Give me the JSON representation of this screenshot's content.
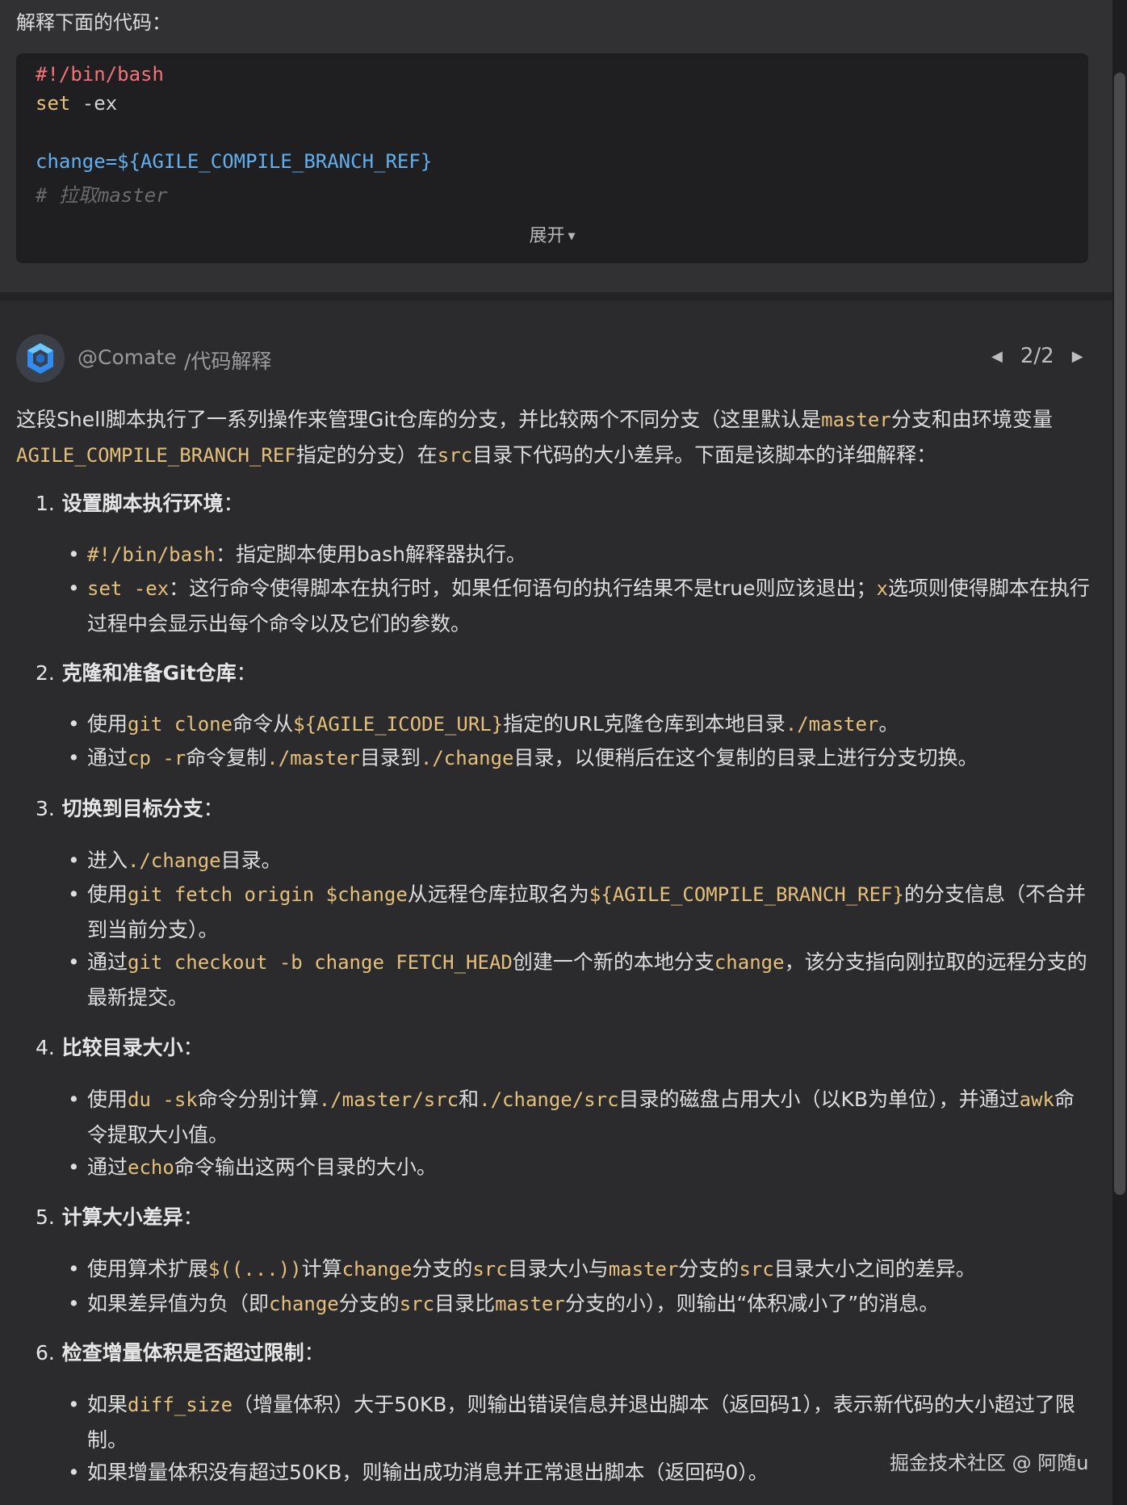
{
  "user": {
    "prompt": "解释下面的代码：",
    "code": {
      "shebang": "#!/bin/bash",
      "set_kw": "set",
      "set_arg": " -ex",
      "change_line": "change=${AGILE_COMPILE_BRANCH_REF}",
      "comment": "# 拉取master",
      "expand_label": "展开",
      "expand_icon": "▼"
    }
  },
  "assistant": {
    "name": "@Comate",
    "command": "/代码解释",
    "page": "2/2",
    "prev_icon": "◀",
    "next_icon": "▶"
  },
  "intro": {
    "p1": "这段Shell脚本执行了一系列操作来管理Git仓库的分支，并比较两个不同分支（这里默认是",
    "c1": "master",
    "p2": "分支和由环境变量",
    "c2": "AGILE_COMPILE_BRANCH_REF",
    "p3": "指定的分支）在",
    "c3": "src",
    "p4": "目录下代码的大小差异。下面是该脚本的详细解释："
  },
  "sections": {
    "s1": {
      "num": "1.",
      "title": "设置脚本执行环境",
      "colon": "：",
      "b1": {
        "c1": "#!/bin/bash",
        "t1": "：指定脚本使用bash解释器执行。"
      },
      "b2": {
        "c1": "set -ex",
        "t1": "：这行命令使得脚本在执行时，如果任何语句的执行结果不是true则应该退出；",
        "c2": "x",
        "t2": "选项则使得脚本在执行过程中会显示出每个命令以及它们的参数。"
      }
    },
    "s2": {
      "num": "2.",
      "title": "克隆和准备Git仓库",
      "colon": "：",
      "b1": {
        "t1": "使用",
        "c1": "git clone",
        "t2": "命令从",
        "c2": "${AGILE_ICODE_URL}",
        "t3": "指定的URL克隆仓库到本地目录",
        "c3": "./master",
        "t4": "。"
      },
      "b2": {
        "t1": "通过",
        "c1": "cp -r",
        "t2": "命令复制",
        "c2": "./master",
        "t3": "目录到",
        "c3": "./change",
        "t4": "目录，以便稍后在这个复制的目录上进行分支切换。"
      }
    },
    "s3": {
      "num": "3.",
      "title": "切换到目标分支",
      "colon": "：",
      "b1": {
        "t1": "进入",
        "c1": "./change",
        "t2": "目录。"
      },
      "b2": {
        "t1": "使用",
        "c1": "git fetch origin $change",
        "t2": "从远程仓库拉取名为",
        "c2": "${AGILE_COMPILE_BRANCH_REF}",
        "t3": "的分支信息（不合并到当前分支）。"
      },
      "b3": {
        "t1": "通过",
        "c1": "git checkout -b change FETCH_HEAD",
        "t2": "创建一个新的本地分支",
        "c2": "change",
        "t3": "，该分支指向刚拉取的远程分支的最新提交。"
      }
    },
    "s4": {
      "num": "4.",
      "title": "比较目录大小",
      "colon": "：",
      "b1": {
        "t1": "使用",
        "c1": "du -sk",
        "t2": "命令分别计算",
        "c2": "./master/src",
        "t3": "和",
        "c3": "./change/src",
        "t4": "目录的磁盘占用大小（以KB为单位），并通过",
        "c4": "awk",
        "t5": "命令提取大小值。"
      },
      "b2": {
        "t1": "通过",
        "c1": "echo",
        "t2": "命令输出这两个目录的大小。"
      }
    },
    "s5": {
      "num": "5.",
      "title": "计算大小差异",
      "colon": "：",
      "b1": {
        "t1": "使用算术扩展",
        "c1": "$((...))",
        "t2": "计算",
        "c2": "change",
        "t3": "分支的",
        "c3": "src",
        "t4": "目录大小与",
        "c4": "master",
        "t5": "分支的",
        "c5": "src",
        "t6": "目录大小之间的差异。"
      },
      "b2": {
        "t1": "如果差异值为负（即",
        "c1": "change",
        "t2": "分支的",
        "c2": "src",
        "t3": "目录比",
        "c3": "master",
        "t4": "分支的小），则输出“体积减小了”的消息。"
      }
    },
    "s6": {
      "num": "6.",
      "title": "检查增量体积是否超过限制",
      "colon": "：",
      "b1": {
        "t1": "如果",
        "c1": "diff_size",
        "t2": "（增量体积）大于50KB，则输出错误信息并退出脚本（返回码1），表示新代码的大小超过了限制。"
      },
      "b2": {
        "t1": "如果增量体积没有超过50KB，则输出成功消息并正常退出脚本（返回码0）。"
      }
    }
  },
  "watermark": "掘金技术社区 @ 阿随u",
  "colors": {
    "background": "#2b2b2d",
    "code_block": "#1f1f21",
    "inline_code": "#e5c07b",
    "shebang": "#f4727a",
    "variable": "#61afef",
    "comment": "#6b6b6b"
  },
  "icons": {
    "avatar": "comate-logo-icon",
    "expand": "caret-down-icon",
    "prev": "caret-left-icon",
    "next": "caret-right-icon"
  }
}
